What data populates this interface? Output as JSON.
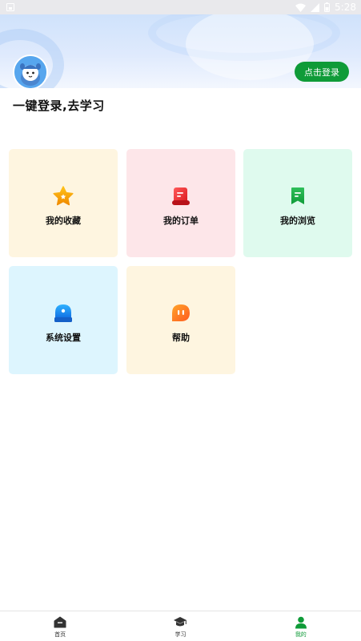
{
  "status_bar": {
    "time": "5:28"
  },
  "header": {
    "login_button": "点击登录",
    "title": "一键登录,去学习"
  },
  "menu": [
    {
      "label": "我的收藏",
      "icon": "star-icon"
    },
    {
      "label": "我的订单",
      "icon": "order-scroll-icon"
    },
    {
      "label": "我的浏览",
      "icon": "bookmark-icon"
    },
    {
      "label": "系统设置",
      "icon": "settings-icon"
    },
    {
      "label": "帮助",
      "icon": "chat-help-icon"
    }
  ],
  "bottom_nav": [
    {
      "label": "首页",
      "icon": "home-icon",
      "active": false
    },
    {
      "label": "学习",
      "icon": "graduation-cap-icon",
      "active": false
    },
    {
      "label": "我的",
      "icon": "person-icon",
      "active": true
    }
  ],
  "colors": {
    "accent": "#0f9b38",
    "banner": "#cfe2fb"
  }
}
